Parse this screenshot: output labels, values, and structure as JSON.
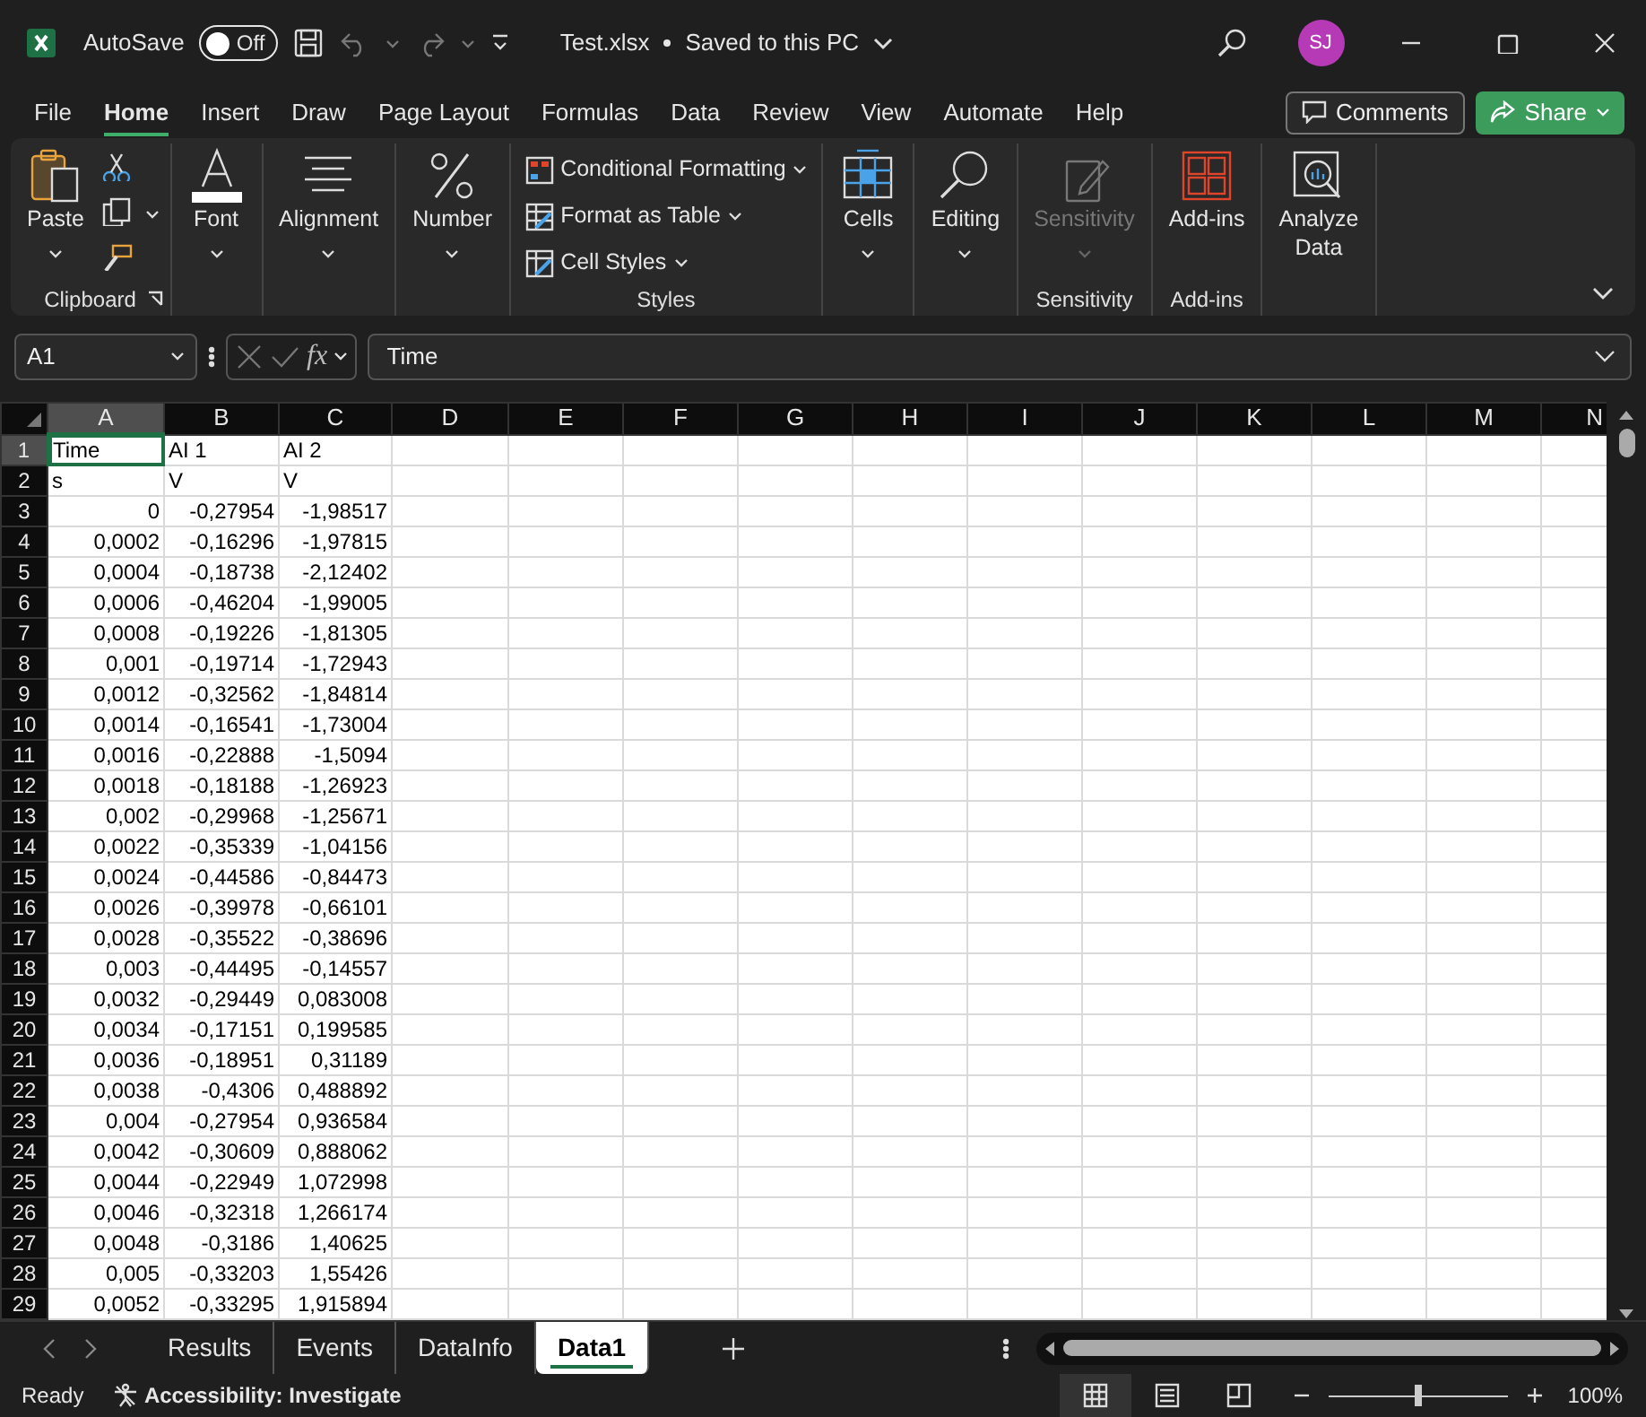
{
  "title_bar": {
    "autosave_label": "AutoSave",
    "autosave_on": false,
    "autosave_state": "Off",
    "file_name": "Test.xlsx",
    "save_status": "Saved to this PC",
    "user_initials": "SJ"
  },
  "menu_tabs": [
    {
      "label": "File",
      "selected": false
    },
    {
      "label": "Home",
      "selected": true
    },
    {
      "label": "Insert",
      "selected": false
    },
    {
      "label": "Draw",
      "selected": false
    },
    {
      "label": "Page Layout",
      "selected": false
    },
    {
      "label": "Formulas",
      "selected": false
    },
    {
      "label": "Data",
      "selected": false
    },
    {
      "label": "Review",
      "selected": false
    },
    {
      "label": "View",
      "selected": false
    },
    {
      "label": "Automate",
      "selected": false
    },
    {
      "label": "Help",
      "selected": false
    }
  ],
  "comments_button": "Comments",
  "share_button": "Share",
  "ribbon": {
    "groups": [
      {
        "label": "Clipboard",
        "launcher": true,
        "items": [
          {
            "kind": "paste",
            "label": "Paste",
            "menu": true
          },
          {
            "kind": "cut"
          },
          {
            "kind": "copy",
            "menu": true
          },
          {
            "kind": "painter"
          }
        ]
      },
      {
        "items": [
          {
            "kind": "font",
            "label": "Font",
            "menu": true
          }
        ]
      },
      {
        "items": [
          {
            "kind": "alignment",
            "label": "Alignment",
            "menu": true
          }
        ]
      },
      {
        "items": [
          {
            "kind": "number",
            "label": "Number",
            "menu": true
          }
        ]
      },
      {
        "label": "Styles",
        "items": [
          {
            "kind": "conditional",
            "label": "Conditional Formatting",
            "menu": true
          },
          {
            "kind": "table",
            "label": "Format as Table",
            "menu": true
          },
          {
            "kind": "styles",
            "label": "Cell Styles",
            "menu": true
          }
        ]
      },
      {
        "items": [
          {
            "kind": "cells",
            "label": "Cells",
            "menu": true
          }
        ]
      },
      {
        "items": [
          {
            "kind": "editing",
            "label": "Editing",
            "menu": true
          }
        ]
      },
      {
        "label": "Sensitivity",
        "items": [
          {
            "kind": "sensitivity",
            "label": "Sensitivity",
            "menu": true,
            "disabled": true
          }
        ]
      },
      {
        "label": "Add-ins",
        "items": [
          {
            "kind": "addins",
            "label": "Add-ins"
          }
        ]
      },
      {
        "items": [
          {
            "kind": "analyze",
            "label": "Analyze Data"
          }
        ]
      }
    ]
  },
  "formula_bar": {
    "name_box": "A1",
    "fx_label": "fx",
    "formula": "Time"
  },
  "grid": {
    "columns": [
      {
        "label": "A",
        "selected": true
      },
      {
        "label": "B",
        "selected": false
      },
      {
        "label": "C",
        "selected": false
      },
      {
        "label": "D",
        "selected": false
      },
      {
        "label": "E",
        "selected": false
      },
      {
        "label": "F",
        "selected": false
      },
      {
        "label": "G",
        "selected": false
      },
      {
        "label": "H",
        "selected": false
      },
      {
        "label": "I",
        "selected": false
      },
      {
        "label": "J",
        "selected": false
      },
      {
        "label": "K",
        "selected": false
      },
      {
        "label": "L",
        "selected": false
      },
      {
        "label": "M",
        "selected": false
      },
      {
        "label": "N",
        "selected": false
      }
    ],
    "rows": [
      {
        "number": "1",
        "kind": "text",
        "selected": true,
        "cells": [
          {
            "text": "Time",
            "selected": true
          },
          {
            "text": "AI 1",
            "selected": false
          },
          {
            "text": "AI 2",
            "selected": false
          }
        ]
      },
      {
        "number": "2",
        "kind": "text",
        "selected": false,
        "cells": [
          "s",
          "V",
          "V"
        ]
      },
      {
        "number": "3",
        "kind": "number",
        "selected": false,
        "cells": [
          "0",
          "-0,27954",
          "-1,98517"
        ]
      },
      {
        "number": "4",
        "kind": "number",
        "selected": false,
        "cells": [
          "0,0002",
          "-0,16296",
          "-1,97815"
        ]
      },
      {
        "number": "5",
        "kind": "number",
        "selected": false,
        "cells": [
          "0,0004",
          "-0,18738",
          "-2,12402"
        ]
      },
      {
        "number": "6",
        "kind": "number",
        "selected": false,
        "cells": [
          "0,0006",
          "-0,46204",
          "-1,99005"
        ]
      },
      {
        "number": "7",
        "kind": "number",
        "selected": false,
        "cells": [
          "0,0008",
          "-0,19226",
          "-1,81305"
        ]
      },
      {
        "number": "8",
        "kind": "number",
        "selected": false,
        "cells": [
          "0,001",
          "-0,19714",
          "-1,72943"
        ]
      },
      {
        "number": "9",
        "kind": "number",
        "selected": false,
        "cells": [
          "0,0012",
          "-0,32562",
          "-1,84814"
        ]
      },
      {
        "number": "10",
        "kind": "number",
        "selected": false,
        "cells": [
          "0,0014",
          "-0,16541",
          "-1,73004"
        ]
      },
      {
        "number": "11",
        "kind": "number",
        "selected": false,
        "cells": [
          "0,0016",
          "-0,22888",
          "-1,5094"
        ]
      },
      {
        "number": "12",
        "kind": "number",
        "selected": false,
        "cells": [
          "0,0018",
          "-0,18188",
          "-1,26923"
        ]
      },
      {
        "number": "13",
        "kind": "number",
        "selected": false,
        "cells": [
          "0,002",
          "-0,29968",
          "-1,25671"
        ]
      },
      {
        "number": "14",
        "kind": "number",
        "selected": false,
        "cells": [
          "0,0022",
          "-0,35339",
          "-1,04156"
        ]
      },
      {
        "number": "15",
        "kind": "number",
        "selected": false,
        "cells": [
          "0,0024",
          "-0,44586",
          "-0,84473"
        ]
      },
      {
        "number": "16",
        "kind": "number",
        "selected": false,
        "cells": [
          "0,0026",
          "-0,39978",
          "-0,66101"
        ]
      },
      {
        "number": "17",
        "kind": "number",
        "selected": false,
        "cells": [
          "0,0028",
          "-0,35522",
          "-0,38696"
        ]
      },
      {
        "number": "18",
        "kind": "number",
        "selected": false,
        "cells": [
          "0,003",
          "-0,44495",
          "-0,14557"
        ]
      },
      {
        "number": "19",
        "kind": "number",
        "selected": false,
        "cells": [
          "0,0032",
          "-0,29449",
          "0,083008"
        ]
      },
      {
        "number": "20",
        "kind": "number",
        "selected": false,
        "cells": [
          "0,0034",
          "-0,17151",
          "0,199585"
        ]
      },
      {
        "number": "21",
        "kind": "number",
        "selected": false,
        "cells": [
          "0,0036",
          "-0,18951",
          "0,31189"
        ]
      },
      {
        "number": "22",
        "kind": "number",
        "selected": false,
        "cells": [
          "0,0038",
          "-0,4306",
          "0,488892"
        ]
      },
      {
        "number": "23",
        "kind": "number",
        "selected": false,
        "cells": [
          "0,004",
          "-0,27954",
          "0,936584"
        ]
      },
      {
        "number": "24",
        "kind": "number",
        "selected": false,
        "cells": [
          "0,0042",
          "-0,30609",
          "0,888062"
        ]
      },
      {
        "number": "25",
        "kind": "number",
        "selected": false,
        "cells": [
          "0,0044",
          "-0,22949",
          "1,072998"
        ]
      },
      {
        "number": "26",
        "kind": "number",
        "selected": false,
        "cells": [
          "0,0046",
          "-0,32318",
          "1,266174"
        ]
      },
      {
        "number": "27",
        "kind": "number",
        "selected": false,
        "cells": [
          "0,0048",
          "-0,3186",
          "1,40625"
        ]
      },
      {
        "number": "28",
        "kind": "number",
        "selected": false,
        "cells": [
          "0,005",
          "-0,33203",
          "1,55426"
        ]
      },
      {
        "number": "29",
        "kind": "number",
        "selected": false,
        "cells": [
          "0,0052",
          "-0,33295",
          "1,915894"
        ]
      }
    ]
  },
  "sheet_tabs": [
    {
      "label": "Results",
      "selected": false
    },
    {
      "label": "Events",
      "selected": false
    },
    {
      "label": "DataInfo",
      "selected": false
    },
    {
      "label": "Data1",
      "selected": true
    }
  ],
  "status_bar": {
    "ready": "Ready",
    "accessibility": "Accessibility: Investigate",
    "views": [
      {
        "kind": "normal",
        "selected": true
      },
      {
        "kind": "layout",
        "selected": false
      },
      {
        "kind": "pagebreak",
        "selected": false
      }
    ],
    "zoom": {
      "level": 0.5,
      "reading": "100%"
    }
  }
}
